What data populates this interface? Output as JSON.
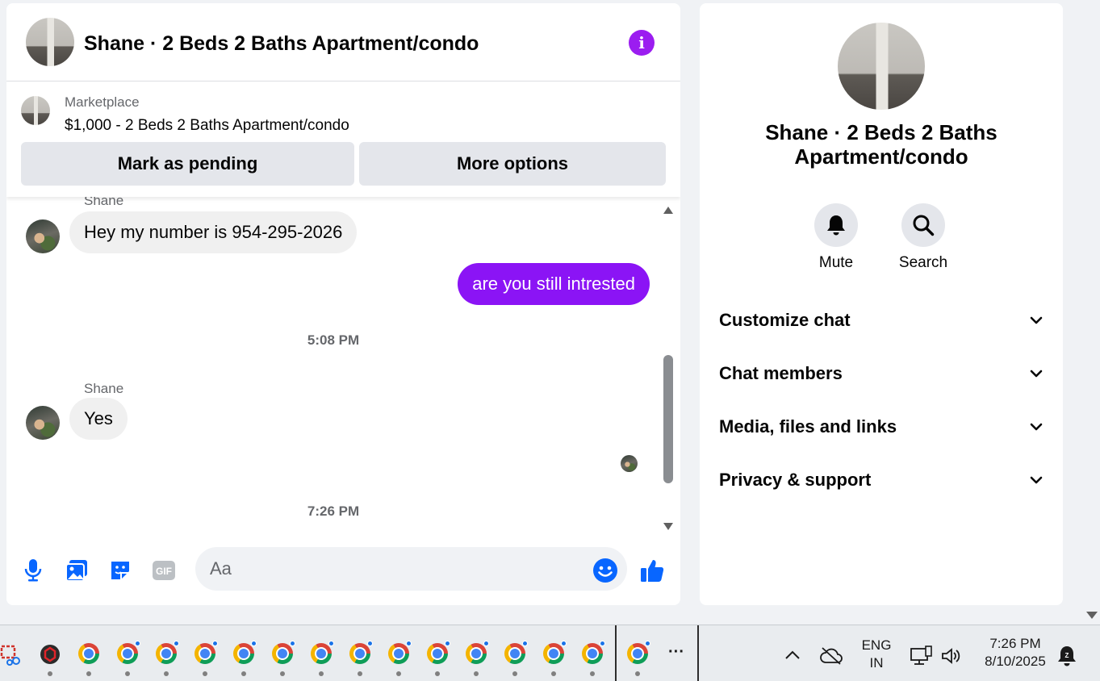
{
  "conversation": {
    "title": "Shane · 2 Beds 2 Baths Apartment/condo",
    "listing": {
      "source_label": "Marketplace",
      "price_title": "$1,000 - 2 Beds 2 Baths Apartment/condo",
      "mark_pending_label": "Mark as pending",
      "more_options_label": "More options"
    },
    "partial_sender": "Shane",
    "messages": [
      {
        "direction": "in",
        "text": "Hey my number is 954-295-2026"
      },
      {
        "direction": "out",
        "text": "are you still intrested"
      }
    ],
    "timestamp_1": "5:08 PM",
    "sender_name": "Shane",
    "reply": {
      "direction": "in",
      "text": "Yes"
    },
    "timestamp_2": "7:26 PM"
  },
  "composer": {
    "placeholder": "Aa",
    "gif_label": "GIF",
    "icons": [
      "microphone-icon",
      "photo-icon",
      "sticker-icon",
      "gif-icon",
      "emoji-icon",
      "thumbs-up-icon"
    ]
  },
  "info_panel": {
    "title": "Shane · 2 Beds 2 Baths Apartment/condo",
    "actions": [
      {
        "label": "Mute",
        "icon": "bell-icon"
      },
      {
        "label": "Search",
        "icon": "search-icon"
      }
    ],
    "sections": [
      {
        "label": "Customize chat"
      },
      {
        "label": "Chat members"
      },
      {
        "label": "Media, files and links"
      },
      {
        "label": "Privacy & support"
      }
    ]
  },
  "taskbar": {
    "language_line1": "ENG",
    "language_line2": "IN",
    "time": "7:26 PM",
    "date": "8/10/2025",
    "overflow_label": "···"
  },
  "colors": {
    "accent": "#8b14f5",
    "info_button": "#9b1df0",
    "messenger_blue": "#0866ff"
  }
}
